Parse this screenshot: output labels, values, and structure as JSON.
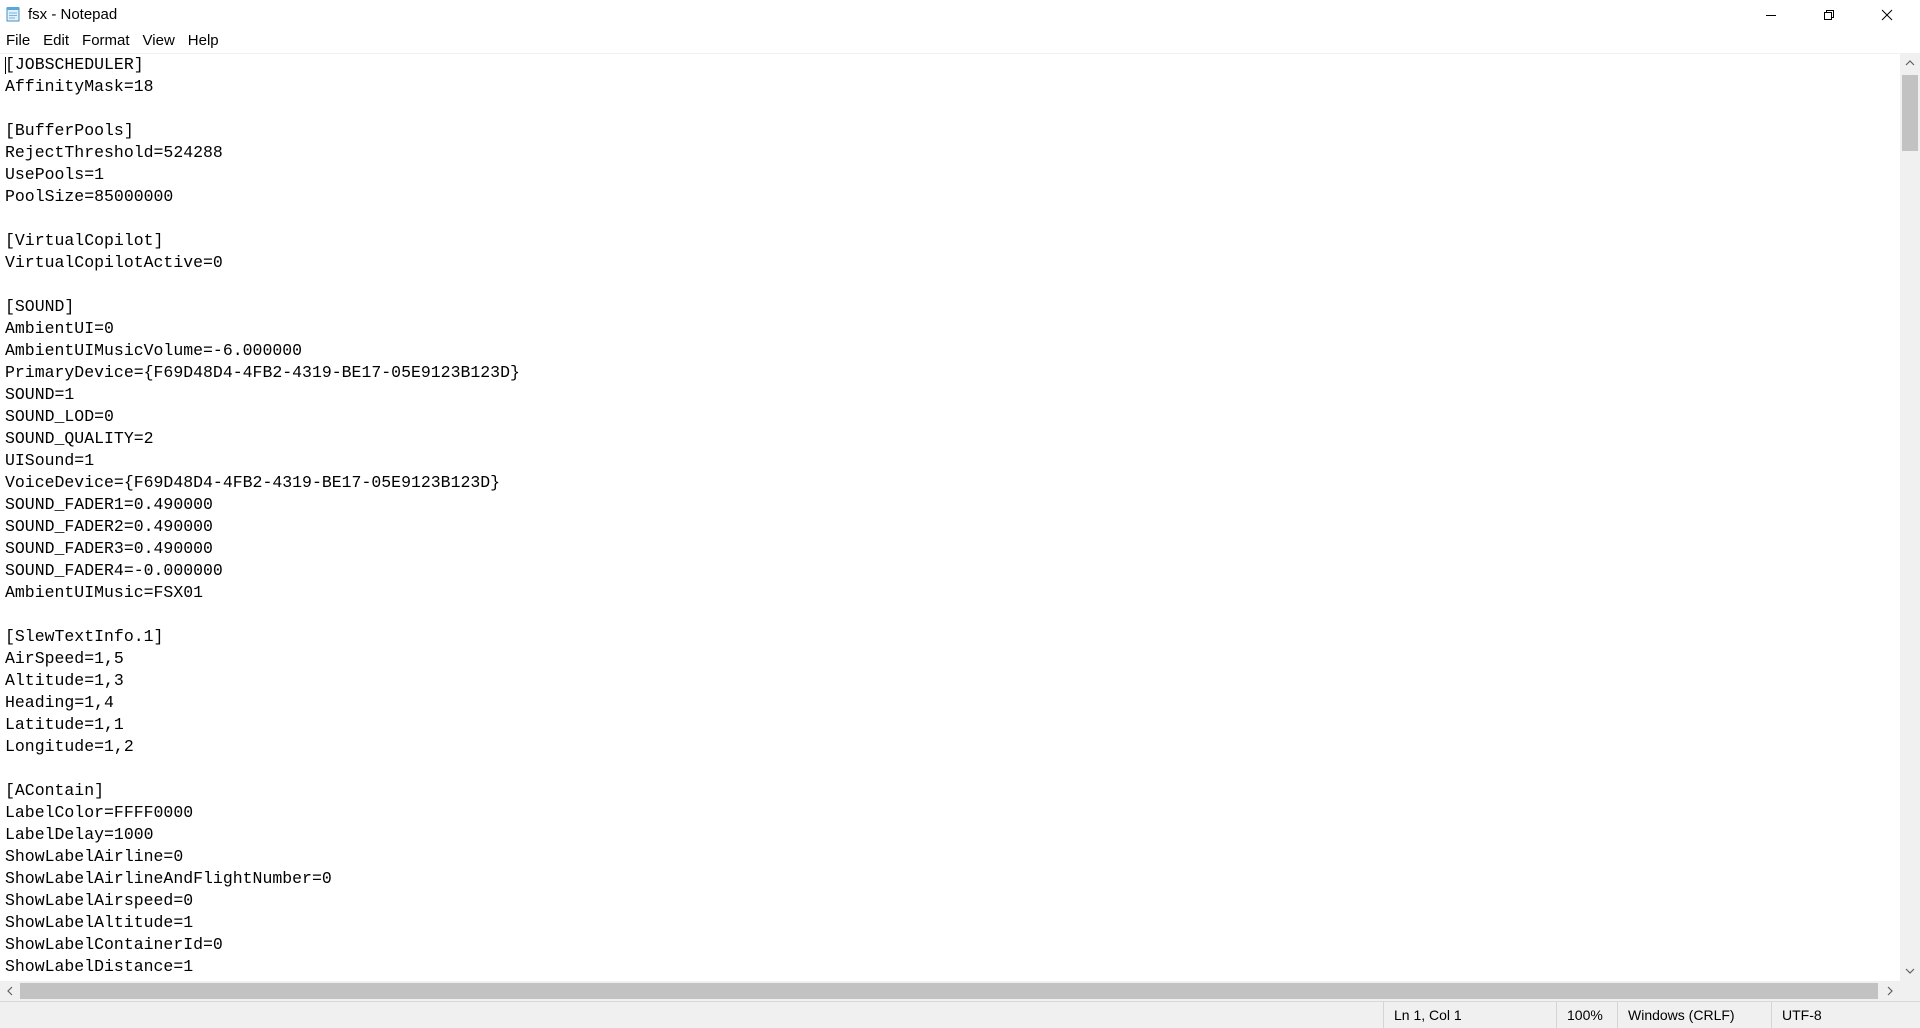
{
  "window": {
    "title": "fsx - Notepad",
    "icons": {
      "app": "notepad-icon",
      "minimize": "minimize-icon",
      "maximize": "restore-icon",
      "close": "close-icon"
    }
  },
  "menu": {
    "items": [
      "File",
      "Edit",
      "Format",
      "View",
      "Help"
    ]
  },
  "editor": {
    "content": "[JOBSCHEDULER]\nAffinityMask=18\n\n[BufferPools]\nRejectThreshold=524288\nUsePools=1\nPoolSize=85000000\n\n[VirtualCopilot]\nVirtualCopilotActive=0\n\n[SOUND]\nAmbientUI=0\nAmbientUIMusicVolume=-6.000000\nPrimaryDevice={F69D48D4-4FB2-4319-BE17-05E9123B123D}\nSOUND=1\nSOUND_LOD=0\nSOUND_QUALITY=2\nUISound=1\nVoiceDevice={F69D48D4-4FB2-4319-BE17-05E9123B123D}\nSOUND_FADER1=0.490000\nSOUND_FADER2=0.490000\nSOUND_FADER3=0.490000\nSOUND_FADER4=-0.000000\nAmbientUIMusic=FSX01\n\n[SlewTextInfo.1]\nAirSpeed=1,5\nAltitude=1,3\nHeading=1,4\nLatitude=1,1\nLongitude=1,2\n\n[AContain]\nLabelColor=FFFF0000\nLabelDelay=1000\nShowLabelAirline=0\nShowLabelAirlineAndFlightNumber=0\nShowLabelAirspeed=0\nShowLabelAltitude=1\nShowLabelContainerId=0\nShowLabelDistance=1"
  },
  "statusbar": {
    "position": "Ln 1, Col 1",
    "zoom": "100%",
    "line_ending": "Windows (CRLF)",
    "encoding": "UTF-8"
  },
  "colors": {
    "scrollbar_track": "#f0f0f0",
    "scrollbar_thumb": "#c2c2c2",
    "statusbar_bg": "#f0f0f0"
  }
}
